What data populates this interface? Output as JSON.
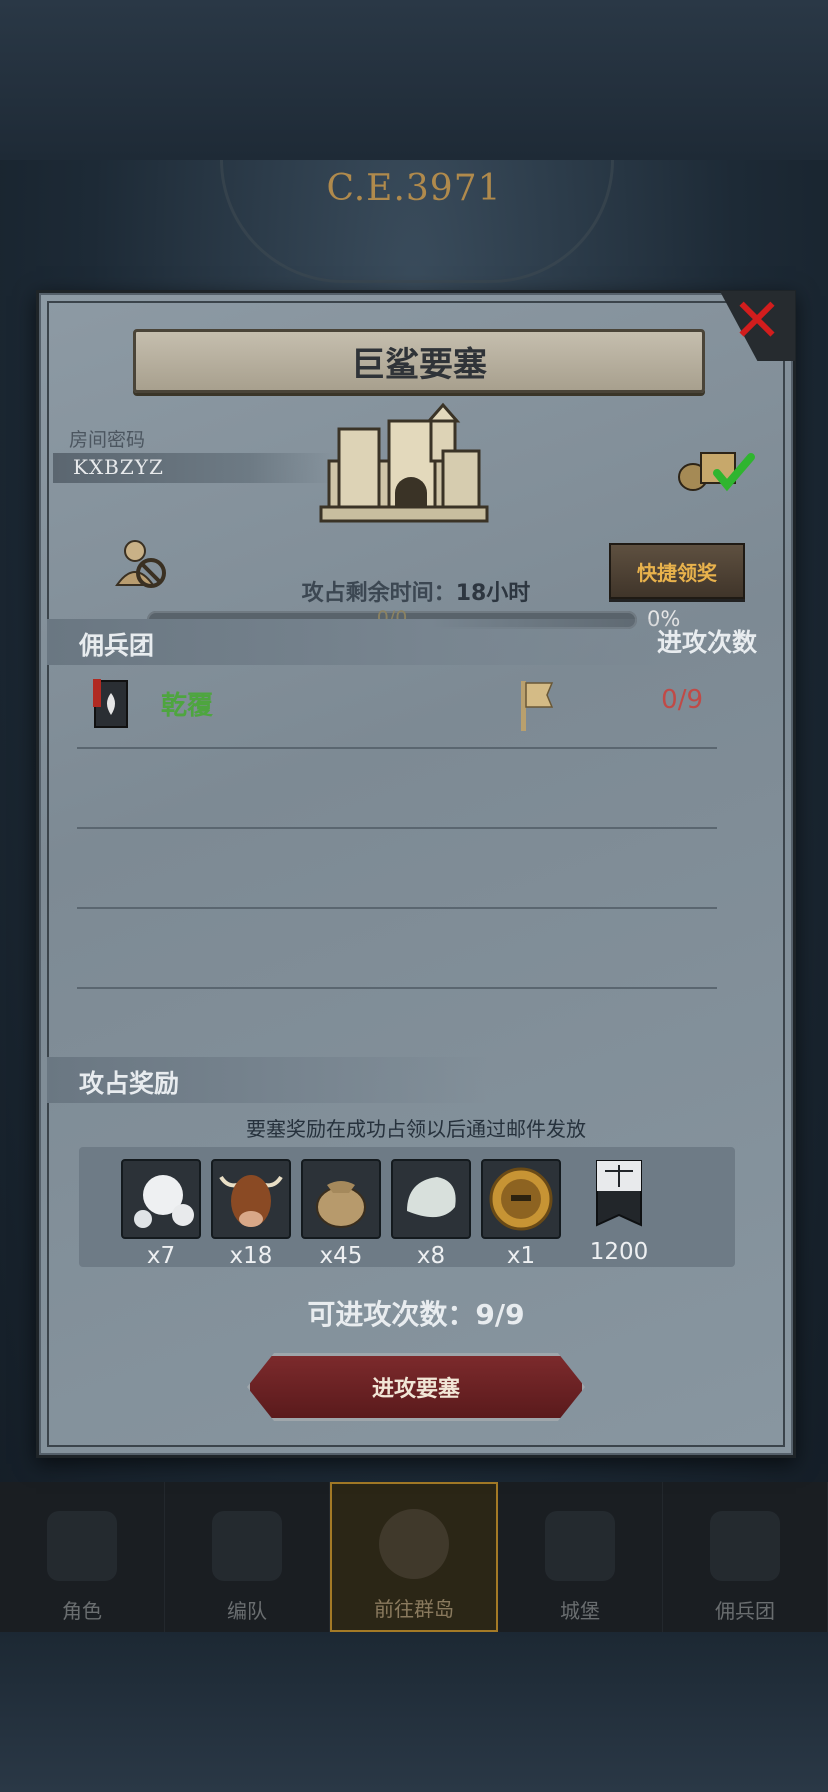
{
  "header": {
    "era": "C.E.3971"
  },
  "dialog": {
    "title": "巨鲨要塞",
    "room_password_label": "房间密码",
    "room_password": "KXBZYZ",
    "quick_claim_label": "快捷领奖",
    "time_left_label": "攻占剩余时间：",
    "time_left_value": "18小时",
    "progress_count": "0/0",
    "progress_percent": "0%",
    "progress_fraction": 0
  },
  "mercenary_section": {
    "header": "佣兵团",
    "attack_count_header": "进攻次数",
    "rows": [
      {
        "name": "乾覆",
        "attacks": "0/9"
      }
    ]
  },
  "reward_section": {
    "header": "攻占奖励",
    "note": "要塞奖励在成功占领以后通过邮件发放",
    "items": [
      {
        "icon": "pearl-icon",
        "count": "x7"
      },
      {
        "icon": "cattle-icon",
        "count": "x18"
      },
      {
        "icon": "sack-icon",
        "count": "x45"
      },
      {
        "icon": "stone-icon",
        "count": "x8"
      },
      {
        "icon": "knight-coin-icon",
        "count": "x1"
      },
      {
        "icon": "justice-banner-icon",
        "count": "1200"
      }
    ]
  },
  "footer": {
    "attacks_left_label": "可进攻次数：",
    "attacks_left_value": "9/9",
    "attack_button_label": "进攻要塞"
  },
  "bottom_nav": [
    {
      "label": "角色"
    },
    {
      "label": "编队"
    },
    {
      "label": "前往群岛"
    },
    {
      "label": "城堡"
    },
    {
      "label": "佣兵团"
    }
  ],
  "colors": {
    "guild_name": "#4ea53f",
    "attack_count": "#c04a47",
    "quick_claim_text": "#e8b24c",
    "close": "#d21d1d"
  }
}
